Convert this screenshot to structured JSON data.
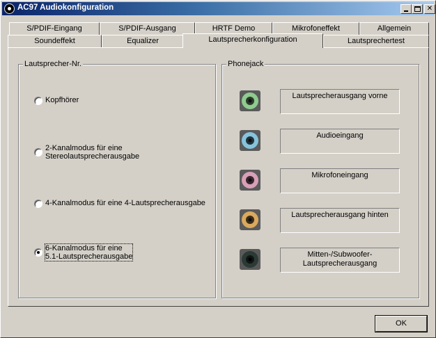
{
  "window": {
    "title": "AC97 Audiokonfiguration"
  },
  "tabs_row1": [
    {
      "label": "S/PDIF-Eingang"
    },
    {
      "label": "S/PDIF-Ausgang"
    },
    {
      "label": "HRTF Demo"
    },
    {
      "label": "Mikrofoneffekt"
    },
    {
      "label": "Allgemein"
    }
  ],
  "tabs_row2": [
    {
      "label": "Soundeffekt"
    },
    {
      "label": "Equalizer"
    },
    {
      "label": "Lautsprecherkonfiguration",
      "active": true
    },
    {
      "label": "Lautsprechertest"
    }
  ],
  "speaker_group": {
    "label": "Lautsprecher-Nr.",
    "options": [
      {
        "label": "Kopfhörer",
        "checked": false
      },
      {
        "label": "2-Kanalmodus für eine\nStereolautsprecherausgabe",
        "checked": false
      },
      {
        "label": "4-Kanalmodus für eine 4-Lautsprecherausgabe",
        "checked": false
      },
      {
        "label": "6-Kanalmodus für eine\n5.1-Lautsprecherausgabe",
        "checked": true
      }
    ]
  },
  "phonejack_group": {
    "label": "Phonejack",
    "jacks": [
      {
        "label": "Lautsprecherausgang vorne",
        "color": "#8fca8f"
      },
      {
        "label": "Audioeingang",
        "color": "#86c3dc"
      },
      {
        "label": "Mikrofoneingang",
        "color": "#d7a0b6"
      },
      {
        "label": "Lautsprecherausgang hinten",
        "color": "#d9a95f"
      },
      {
        "label": "Mitten-/Subwoofer-\nLautsprecherausgang",
        "color": "#2c3a35"
      }
    ]
  },
  "buttons": {
    "ok": "OK"
  },
  "colors": {
    "face": "#d4d0c8",
    "title_start": "#0a246a",
    "title_end": "#a6caf0"
  }
}
